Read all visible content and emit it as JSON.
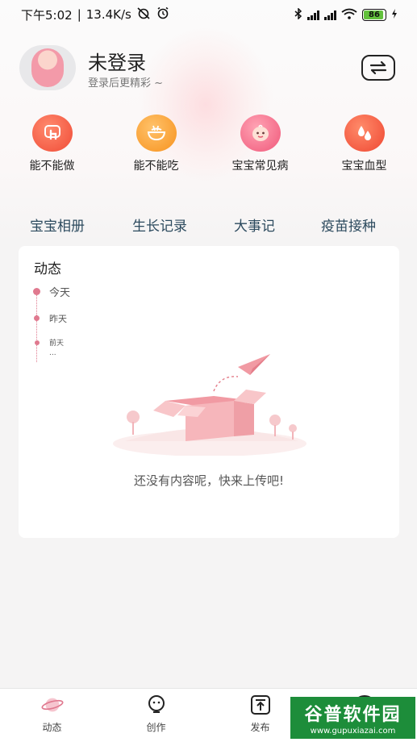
{
  "status_bar": {
    "time": "下午5:02",
    "speed": "13.4K/s",
    "battery": "86"
  },
  "header": {
    "name": "未登录",
    "subtitle": "登录后更精彩 ~"
  },
  "features": [
    {
      "label": "能不能做",
      "icon": "hand-tap-icon"
    },
    {
      "label": "能不能吃",
      "icon": "bowl-icon"
    },
    {
      "label": "宝宝常见病",
      "icon": "baby-face-icon"
    },
    {
      "label": "宝宝血型",
      "icon": "blood-drops-icon"
    }
  ],
  "tabs": [
    "宝宝相册",
    "生长记录",
    "大事记",
    "疫苗接种"
  ],
  "feed": {
    "title": "动态",
    "timeline": [
      "今天",
      "昨天",
      "前天",
      "..."
    ],
    "empty_text": "还没有内容呢，快来上传吧!"
  },
  "bottom_nav": [
    {
      "label": "动态",
      "icon": "planet-icon",
      "active": true
    },
    {
      "label": "创作",
      "icon": "bulb-icon",
      "active": false
    },
    {
      "label": "发布",
      "icon": "upload-icon",
      "active": false
    },
    {
      "label": "",
      "icon": "chat-icon",
      "active": false
    }
  ],
  "watermark": {
    "title": "谷普软件园",
    "url": "www.gupuxiazai.com"
  },
  "colors": {
    "accent": "#e0798f",
    "tab_text": "#2c4a5e",
    "watermark_bg": "#1d8d3a"
  }
}
